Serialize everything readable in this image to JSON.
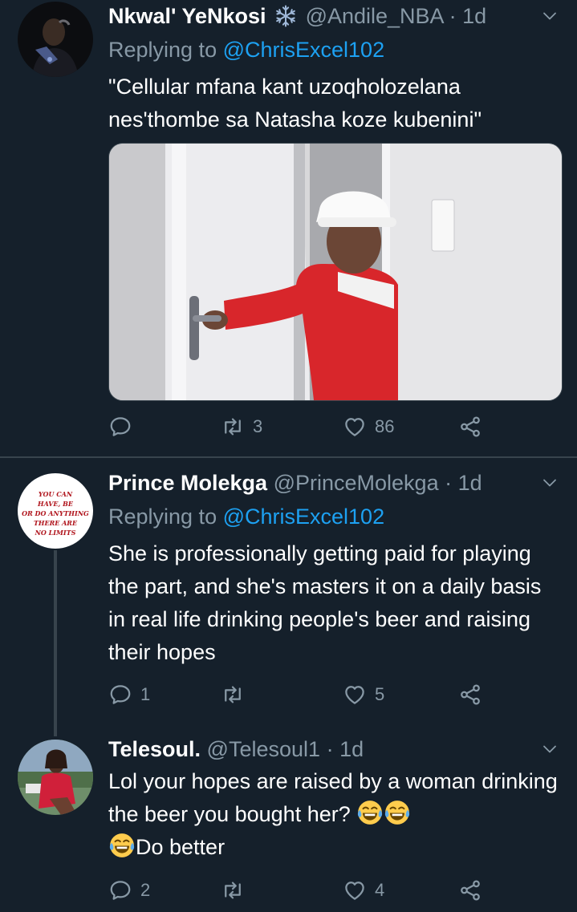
{
  "tweets": [
    {
      "name": "Nkwal' YeNkosi",
      "handle": "@Andile_NBA",
      "time": "1d",
      "replying_label": "Replying to",
      "replying_to": "@ChrisExcel102",
      "text": "\"Cellular mfana kant uzoqholozelana nes'thombe sa Natasha koze kubenini\"",
      "replies": "",
      "retweets": "3",
      "likes": "86"
    },
    {
      "name": "Prince Molekga",
      "handle": "@PrinceMolekga",
      "time": "1d",
      "replying_label": "Replying to",
      "replying_to": "@ChrisExcel102",
      "text": "She is professionally getting paid for playing the part, and she's masters it on a daily basis in real life drinking people's beer and raising their hopes",
      "avatar_text": [
        "YOU CAN",
        "HAVE, BE",
        "OR DO ANYTHING",
        "THERE ARE",
        "NO LIMITS"
      ],
      "replies": "1",
      "retweets": "",
      "likes": "5"
    },
    {
      "name": "Telesoul.",
      "handle": "@Telesoul1",
      "time": "1d",
      "text_part1": "Lol your hopes are raised by a woman drinking the beer you bought her?",
      "text_part2": "Do better",
      "replies": "2",
      "retweets": "",
      "likes": "4"
    }
  ],
  "separator": "·",
  "icons": {
    "verified_like_emoji": "snowflake-icon",
    "reply": "reply-icon",
    "retweet": "retweet-icon",
    "like": "heart-icon",
    "share": "share-icon",
    "more": "chevron-down-icon",
    "laughing": "tears-of-joy-emoji"
  },
  "colors": {
    "background": "#15202b",
    "muted": "#8899a6",
    "accent": "#1da1f2",
    "divider": "#38444d"
  }
}
